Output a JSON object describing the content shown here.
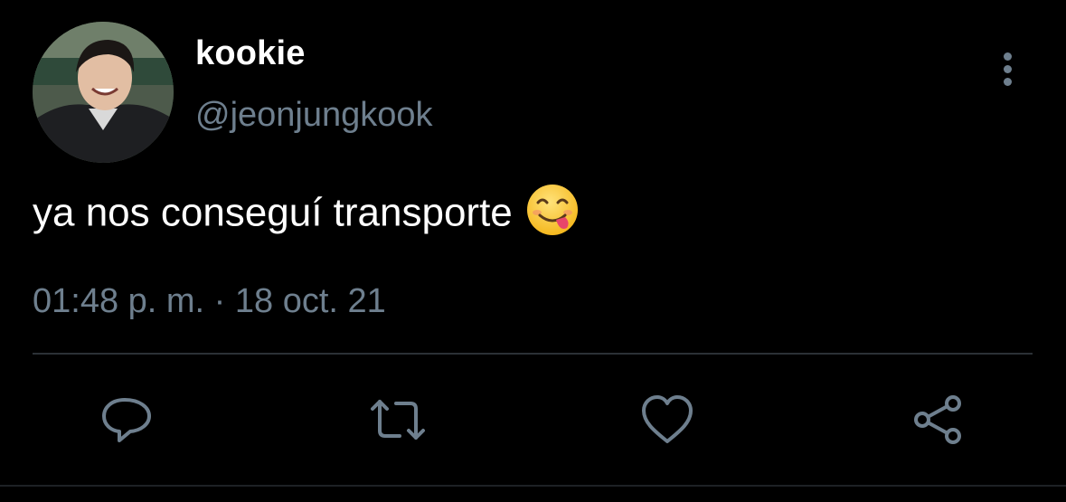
{
  "user": {
    "display_name": "kookie",
    "handle": "@jeonjungkook"
  },
  "tweet": {
    "text": "ya nos conseguí transporte",
    "emoji": "face-savoring-food-emoji",
    "timestamp": "01:48 p. m. · 18 oct. 21"
  },
  "actions": [
    {
      "name": "reply",
      "icon": "reply-bubble-icon"
    },
    {
      "name": "retweet",
      "icon": "retweet-arrows-icon"
    },
    {
      "name": "like",
      "icon": "heart-icon"
    },
    {
      "name": "share",
      "icon": "share-nodes-icon"
    }
  ],
  "colors": {
    "background": "#000000",
    "primary_text": "#ffffff",
    "secondary_text": "#6e7f8e",
    "divider": "#2b3136",
    "icon": "#6e7f8e"
  }
}
